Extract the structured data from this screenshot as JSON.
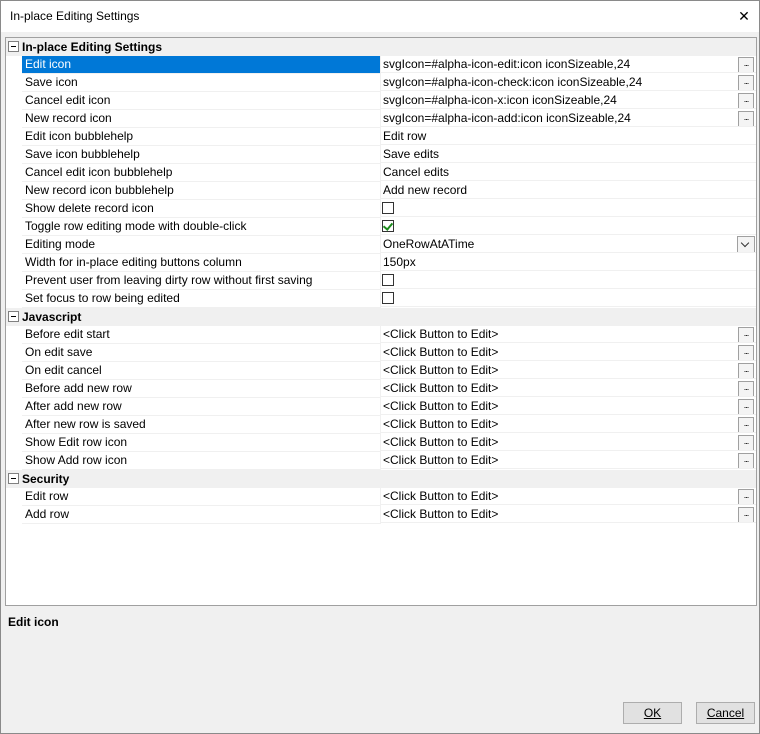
{
  "window": {
    "title": "In-place Editing Settings",
    "close_glyph": "✕"
  },
  "categories": [
    {
      "label": "In-place Editing Settings",
      "rows": [
        {
          "name": "Edit icon",
          "value": "svgIcon=#alpha-icon-edit:icon iconSizeable,24",
          "control": "ellipsis",
          "selected": true
        },
        {
          "name": "Save icon",
          "value": "svgIcon=#alpha-icon-check:icon iconSizeable,24",
          "control": "ellipsis"
        },
        {
          "name": "Cancel edit icon",
          "value": "svgIcon=#alpha-icon-x:icon iconSizeable,24",
          "control": "ellipsis"
        },
        {
          "name": "New record icon",
          "value": "svgIcon=#alpha-icon-add:icon iconSizeable,24",
          "control": "ellipsis"
        },
        {
          "name": "Edit icon bubblehelp",
          "value": "Edit row",
          "control": "text"
        },
        {
          "name": "Save icon bubblehelp",
          "value": "Save edits",
          "control": "text"
        },
        {
          "name": "Cancel edit icon bubblehelp",
          "value": "Cancel edits",
          "control": "text"
        },
        {
          "name": "New record icon bubblehelp",
          "value": "Add new record",
          "control": "text"
        },
        {
          "name": "Show delete record icon",
          "value": "",
          "control": "checkbox",
          "checked": false
        },
        {
          "name": "Toggle row editing mode with double-click",
          "value": "",
          "control": "checkbox",
          "checked": true
        },
        {
          "name": "Editing mode",
          "value": "OneRowAtATime",
          "control": "dropdown"
        },
        {
          "name": "Width for in-place editing buttons column",
          "value": "150px",
          "control": "text"
        },
        {
          "name": "Prevent user from leaving dirty row without first saving",
          "value": "",
          "control": "checkbox",
          "checked": false
        },
        {
          "name": "Set focus to row being edited",
          "value": "",
          "control": "checkbox",
          "checked": false
        }
      ]
    },
    {
      "label": "Javascript",
      "rows": [
        {
          "name": "Before edit start",
          "value": "<Click Button to Edit>",
          "control": "ellipsis"
        },
        {
          "name": "On edit save",
          "value": "<Click Button to Edit>",
          "control": "ellipsis"
        },
        {
          "name": "On edit cancel",
          "value": "<Click Button to Edit>",
          "control": "ellipsis"
        },
        {
          "name": "Before add new row",
          "value": "<Click Button to Edit>",
          "control": "ellipsis"
        },
        {
          "name": "After add new row",
          "value": "<Click Button to Edit>",
          "control": "ellipsis"
        },
        {
          "name": "After new row is saved",
          "value": "<Click Button to Edit>",
          "control": "ellipsis"
        },
        {
          "name": "Show Edit row icon",
          "value": "<Click Button to Edit>",
          "control": "ellipsis"
        },
        {
          "name": "Show Add row icon",
          "value": "<Click Button to Edit>",
          "control": "ellipsis"
        }
      ]
    },
    {
      "label": "Security",
      "rows": [
        {
          "name": "Edit row",
          "value": "<Click Button to Edit>",
          "control": "ellipsis"
        },
        {
          "name": "Add row",
          "value": "<Click Button to Edit>",
          "control": "ellipsis"
        }
      ]
    }
  ],
  "ellipsis_glyph": "...",
  "help_text": "Edit icon",
  "buttons": {
    "ok": "OK",
    "cancel": "Cancel"
  },
  "colors": {
    "selection": "#0078d7",
    "category_bg": "#f0f0f0"
  }
}
